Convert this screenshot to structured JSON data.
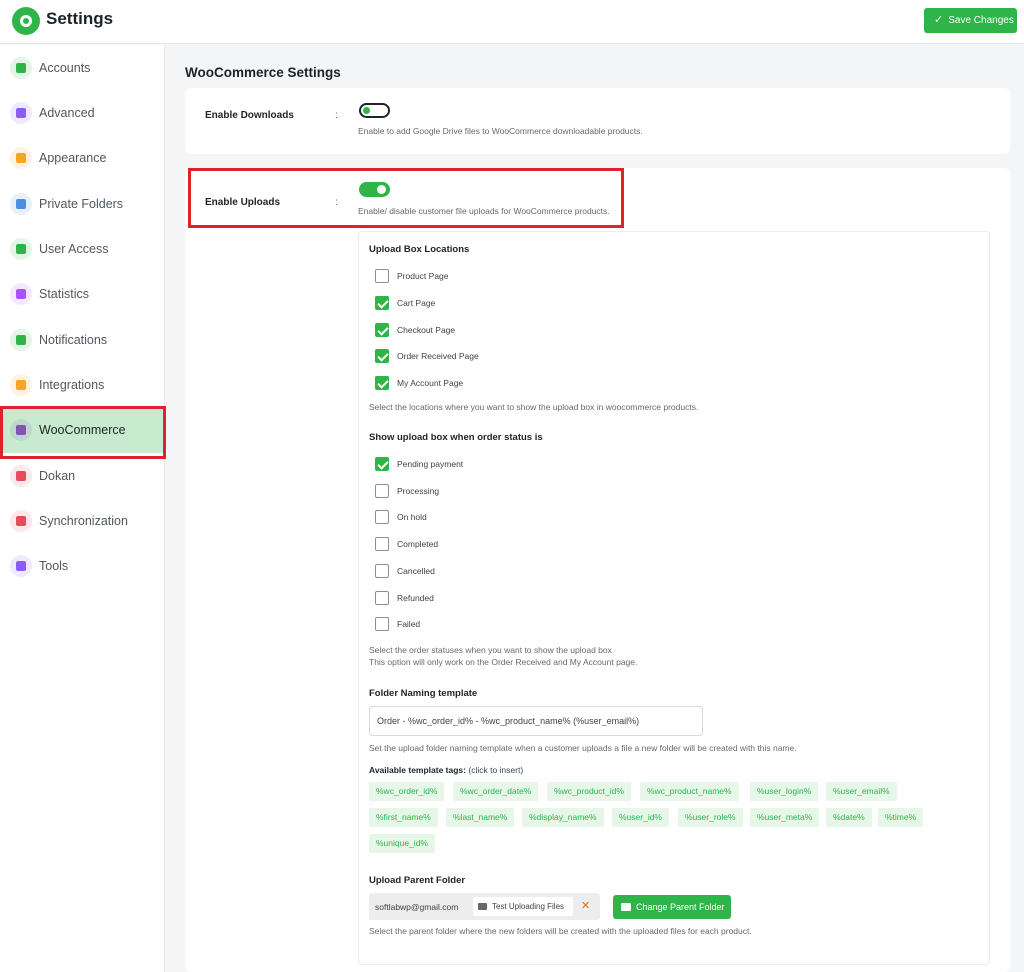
{
  "header": {
    "title": "Settings",
    "save_label": "Save Changes"
  },
  "colors": {
    "accent": "#2fb44a",
    "highlight": "#e0232a",
    "active_bg": "#c8ebcf"
  },
  "sidebar": {
    "items": [
      {
        "label": "Accounts",
        "icon": "user-icon",
        "color": "#2fb44a"
      },
      {
        "label": "Advanced",
        "icon": "advanced-icon",
        "color": "#8b5cf6"
      },
      {
        "label": "Appearance",
        "icon": "palette-icon",
        "color": "#f5a623"
      },
      {
        "label": "Private Folders",
        "icon": "folder-icon",
        "color": "#4a90e2"
      },
      {
        "label": "User Access",
        "icon": "user-access-icon",
        "color": "#2fb44a"
      },
      {
        "label": "Statistics",
        "icon": "chart-pie-icon",
        "color": "#a855f7"
      },
      {
        "label": "Notifications",
        "icon": "bell-user-icon",
        "color": "#2fb44a"
      },
      {
        "label": "Integrations",
        "icon": "grid-icon",
        "color": "#f5a623"
      },
      {
        "label": "WooCommerce",
        "icon": "woocommerce-icon",
        "color": "#7f54b3"
      },
      {
        "label": "Dokan",
        "icon": "dokan-icon",
        "color": "#e74c5b"
      },
      {
        "label": "Synchronization",
        "icon": "sync-icon",
        "color": "#e74c5b"
      },
      {
        "label": "Tools",
        "icon": "tools-icon",
        "color": "#8b5cf6"
      }
    ]
  },
  "main": {
    "title": "WooCommerce Settings",
    "downloads": {
      "label": "Enable Downloads",
      "colon": ":",
      "enabled": false,
      "desc": "Enable to add Google Drive files to WooCommerce downloadable products."
    },
    "uploads": {
      "label": "Enable Uploads",
      "colon": ":",
      "enabled": true,
      "desc": "Enable/ disable customer file uploads for WooCommerce products."
    },
    "locations": {
      "title": "Upload Box Locations",
      "options": [
        {
          "label": "Product Page",
          "checked": false
        },
        {
          "label": "Cart Page",
          "checked": true
        },
        {
          "label": "Checkout Page",
          "checked": true
        },
        {
          "label": "Order Received Page",
          "checked": true
        },
        {
          "label": "My Account Page",
          "checked": true
        }
      ],
      "desc": "Select the locations where you want to show the upload box in woocommerce products."
    },
    "statuses": {
      "title": "Show upload box when order status is",
      "options": [
        {
          "label": "Pending payment",
          "checked": true
        },
        {
          "label": "Processing",
          "checked": false
        },
        {
          "label": "On hold",
          "checked": false
        },
        {
          "label": "Completed",
          "checked": false
        },
        {
          "label": "Cancelled",
          "checked": false
        },
        {
          "label": "Refunded",
          "checked": false
        },
        {
          "label": "Failed",
          "checked": false
        }
      ],
      "desc1": "Select the order statuses when you want to show the upload box",
      "desc2": "This option will only work on the Order Received and My Account page."
    },
    "naming": {
      "title": "Folder Naming template",
      "value": "Order - %wc_order_id% - %wc_product_name% (%user_email%)",
      "desc": "Set the upload folder naming template when a customer uploads a file a new folder will be created with this name.",
      "tags_label": "Available template tags:",
      "tags_hint": "(click to insert)",
      "tags": [
        "%wc_order_id%",
        "%wc_order_date%",
        "%wc_product_id%",
        "%wc_product_name%",
        "%user_login%",
        "%user_email%",
        "%first_name%",
        "%last_name%",
        "%display_name%",
        "%user_id%",
        "%user_role%",
        "%user_meta%",
        "%date%",
        "%time%",
        "%unique_id%"
      ]
    },
    "parent": {
      "title": "Upload Parent Folder",
      "account": "softlabwp@gmail.com",
      "folder": "Test Uploading Files",
      "remove": "✕",
      "button": "Change Parent Folder",
      "desc": "Select the parent folder where the new folders will be created with the uploaded files for each product."
    }
  }
}
